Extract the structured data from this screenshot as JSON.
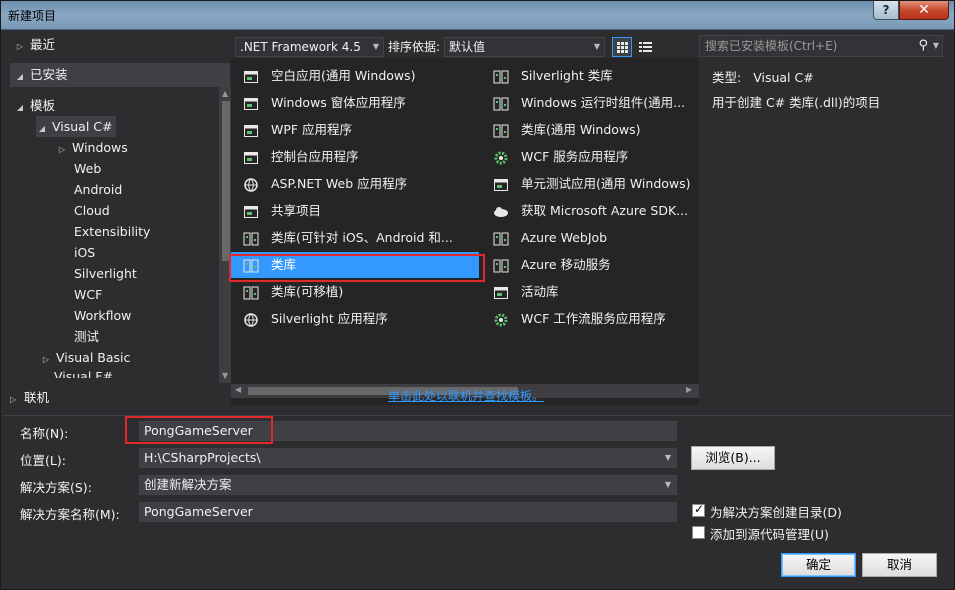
{
  "window": {
    "title": "新建项目",
    "help": "?",
    "close": "✕"
  },
  "tree": {
    "recent": "最近",
    "installed": "已安装",
    "templates": "模板",
    "visual_csharp": "Visual C#",
    "children": [
      "Windows",
      "Web",
      "Android",
      "Cloud",
      "Extensibility",
      "iOS",
      "Silverlight",
      "WCF",
      "Workflow",
      "测试"
    ],
    "visual_basic": "Visual Basic",
    "cut_item": "Visual F#",
    "online": "联机"
  },
  "toolbar": {
    "framework": ".NET Framework 4.5",
    "sort_label": "排序依据:",
    "sort_value": "默认值"
  },
  "templates_left": [
    "空白应用(通用 Windows)",
    "Windows 窗体应用程序",
    "WPF 应用程序",
    "控制台应用程序",
    "ASP.NET Web 应用程序",
    "共享项目",
    "类库(可针对 iOS、Android 和...",
    "类库",
    "类库(可移植)",
    "Silverlight 应用程序"
  ],
  "templates_right": [
    "Silverlight 类库",
    "Windows 运行时组件(通用...",
    "类库(通用 Windows)",
    "WCF 服务应用程序",
    "单元测试应用(通用 Windows)",
    "获取 Microsoft Azure SDK...",
    "Azure WebJob",
    "Azure 移动服务",
    "活动库",
    "WCF 工作流服务应用程序"
  ],
  "search": {
    "placeholder": "搜索已安装模板(Ctrl+E)"
  },
  "details": {
    "type_label": "类型:",
    "type_value": "Visual C#",
    "description": "用于创建 C# 类库(.dll)的项目"
  },
  "online_link": "单击此处以联机并查找模板。",
  "form": {
    "name_label": "名称(N):",
    "name_value": "PongGameServer",
    "location_label": "位置(L):",
    "location_value": "H:\\CSharpProjects\\",
    "solution_label": "解决方案(S):",
    "solution_value": "创建新解决方案",
    "solution_name_label": "解决方案名称(M):",
    "solution_name_value": "PongGameServer",
    "browse": "浏览(B)...",
    "create_dir": "为解决方案创建目录(D)",
    "create_dir_checked": true,
    "add_source_control": "添加到源代码管理(U)",
    "add_source_control_checked": false,
    "ok": "确定",
    "cancel": "取消"
  }
}
